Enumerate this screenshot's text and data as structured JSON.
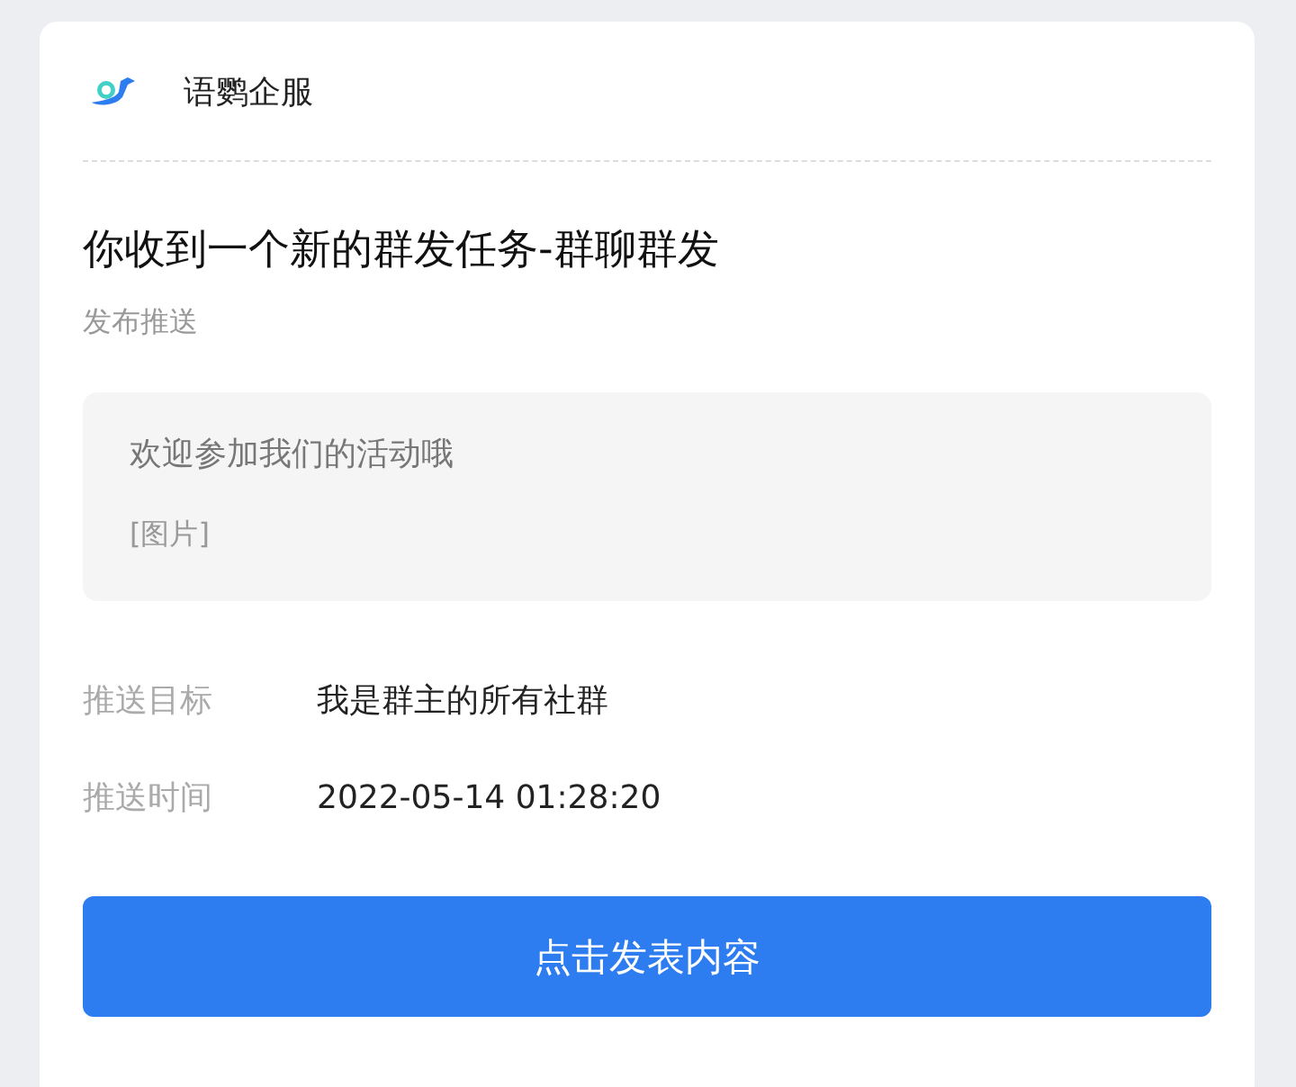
{
  "header": {
    "brand": "语鹦企服"
  },
  "title": "你收到一个新的群发任务-群聊群发",
  "subtitle": "发布推送",
  "message": {
    "text": "欢迎参加我们的活动哦",
    "attachment": "[图片]"
  },
  "fields": [
    {
      "label": "推送目标",
      "value": "我是群主的所有社群"
    },
    {
      "label": "推送时间",
      "value": "2022-05-14 01:28:20"
    }
  ],
  "button": "点击发表内容"
}
